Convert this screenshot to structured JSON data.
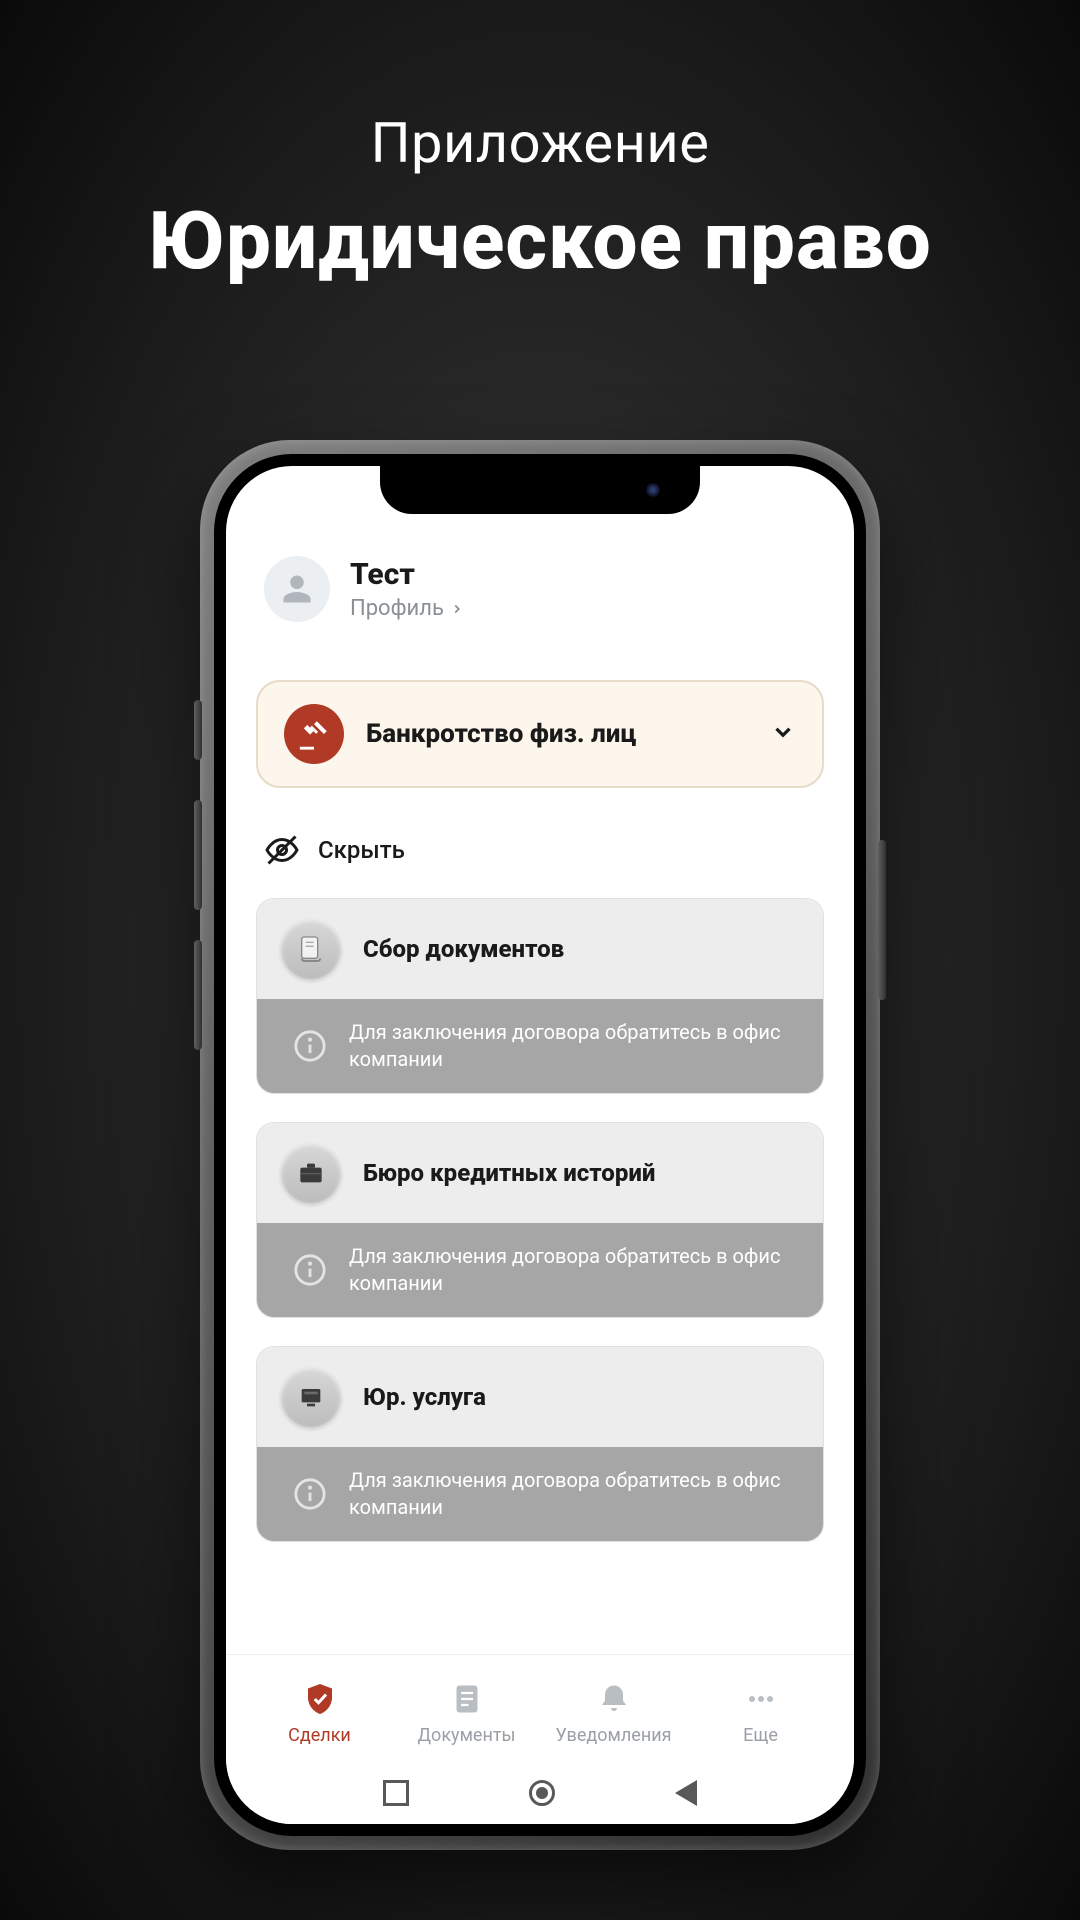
{
  "hero": {
    "kicker": "Приложение",
    "title": "Юридическое право"
  },
  "profile": {
    "name": "Тест",
    "link_label": "Профиль"
  },
  "category": {
    "label": "Банкротство физ. лиц"
  },
  "hide": {
    "label": "Скрыть"
  },
  "cards": [
    {
      "title": "Сбор документов",
      "subtitle": "Для заключения договора обратитесь в офис компании"
    },
    {
      "title": "Бюро кредитных историй",
      "subtitle": "Для заключения договора обратитесь в офис компании"
    },
    {
      "title": "Юр. услуга",
      "subtitle": "Для заключения договора обратитесь в офис компании"
    }
  ],
  "tabs": [
    {
      "label": "Сделки",
      "active": true
    },
    {
      "label": "Документы",
      "active": false
    },
    {
      "label": "Уведомления",
      "active": false
    },
    {
      "label": "Еще",
      "active": false
    }
  ],
  "colors": {
    "accent": "#b13a26"
  }
}
